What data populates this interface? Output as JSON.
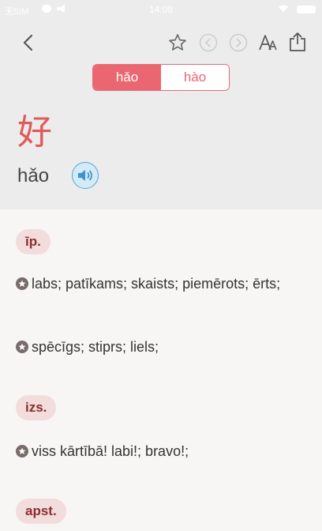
{
  "status_bar": {
    "carrier": "无SIM",
    "time": "14:08"
  },
  "toolbar": {
    "back_icon": "chevron-left-icon",
    "favorite_icon": "star-icon",
    "prev_icon": "circle-arrow-left-icon",
    "next_icon": "circle-arrow-right-icon",
    "font_icon": "font-size-icon",
    "share_icon": "share-icon"
  },
  "tone_tabs": [
    {
      "label": "hǎo",
      "active": true
    },
    {
      "label": "hào",
      "active": false
    }
  ],
  "word": {
    "hanzi": "好",
    "pinyin": "hǎo",
    "audio_icon": "speaker-icon"
  },
  "colors": {
    "accent": "#ea6670",
    "hanzi": "#e05a5a",
    "pos_badge_bg": "#f3dcdc",
    "pos_badge_text": "#8a2e2e"
  },
  "sections": [
    {
      "pos": "īp.",
      "meanings": [
        "labs; patīkams; skaists; piemērots; ērts;",
        "spēcīgs; stiprs; liels;"
      ]
    },
    {
      "pos": "izs.",
      "meanings": [
        "viss kārtībā! labi!; bravo!;"
      ]
    },
    {
      "pos": "apst.",
      "meanings": []
    }
  ]
}
